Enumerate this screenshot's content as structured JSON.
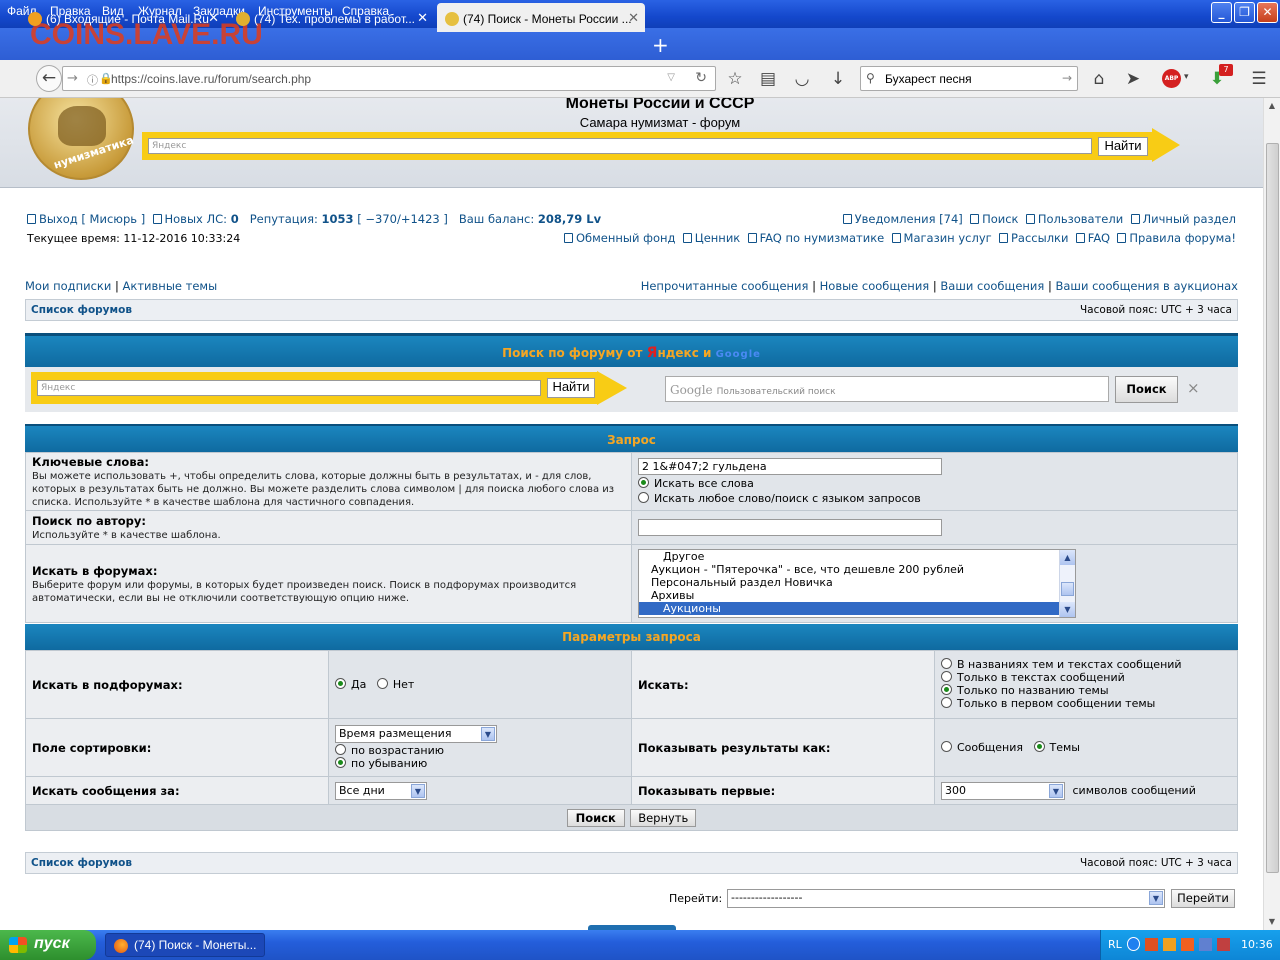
{
  "menu": [
    "Файл",
    "Правка",
    "Вид",
    "Журнал",
    "Закладки",
    "Инструменты",
    "Справка"
  ],
  "watermark": "COINS.LAVE.RU",
  "tabs": [
    {
      "label": "(6) Входящие - Почта Mail.Ru"
    },
    {
      "label": "(74) Тех. проблемы в работ..."
    },
    {
      "label": "(74) Поиск - Монеты России ..."
    }
  ],
  "url": "https://coins.lave.ru/forum/search.php",
  "browser_search": "Бухарест песня",
  "abp_badge": "ABP",
  "download_badge": "7",
  "site": {
    "title": "Монеты России и СССР",
    "subtitle": "Самара нумизмат - форум",
    "logo_text": "нумизматика",
    "yandex_placeholder": "Яндекс",
    "find_button": "Найти"
  },
  "userbar": {
    "logout": "Выход [ Мисюрь ]",
    "new_pm_label": "Новых ЛС:",
    "new_pm": "0",
    "reputation_label": "Репутация:",
    "reputation": "1053",
    "reputation_range": "[ −370/+1423 ]",
    "balance_label": "Ваш баланс:",
    "balance": "208,79 Lv",
    "current_time": "Текущее время: 11-12-2016 10:33:24",
    "right_row1": [
      "Уведомления [74]",
      "Поиск",
      "Пользователи",
      "Личный раздел"
    ],
    "right_row2": [
      "Обменный фонд",
      "Ценник",
      "FAQ по нумизматике",
      "Магазин услуг",
      "Рассылки",
      "FAQ",
      "Правила форума!"
    ]
  },
  "links_left": [
    "Мои подписки",
    "Активные темы"
  ],
  "links_right": [
    "Непрочитанные сообщения",
    "Новые сообщения",
    "Ваши сообщения",
    "Ваши сообщения в аукционах"
  ],
  "breadcrumb": "Список форумов",
  "timezone": "Часовой пояс: UTC + 3 часа",
  "search_section": {
    "title_prefix": "Поиск по форуму от ",
    "ya_Y": "Я",
    "ya_rest": "ндекс",
    "and": " и ",
    "google": "Google",
    "yandex_placeholder": "Яндекс",
    "find_button": "Найти",
    "google_placeholder": "Пользовательский поиск",
    "google_button": "Поиск",
    "clear": "×"
  },
  "query": {
    "header": "Запрос",
    "keywords_label": "Ключевые слова:",
    "keywords_help": "Вы можете использовать +, чтобы определить слова, которые должны быть в результатах, и - для слов, которых в результатах быть не должно. Вы можете разделить слова символом | для поиска любого слова из списка. Используйте * в качестве шаблона для частичного совпадения.",
    "keywords_value": "2 1&#047;2 гульдена",
    "opt_all": "Искать все слова",
    "opt_any": "Искать любое слово/поиск с языком запросов",
    "author_label": "Поиск по автору:",
    "author_help": "Используйте * в качестве шаблона.",
    "author_value": "",
    "forums_label": "Искать в форумах:",
    "forums_help": "Выберите форум или форумы, в которых будет произведен поиск. Поиск в подфорумах производится автоматически, если вы не отключили соответствующую опцию ниже.",
    "forums_list": [
      "Другое",
      "Аукцион - \"Пятерочка\" - все, что дешевле 200 рублей",
      "Персональный раздел Новичка",
      "Архивы",
      "Аукционы"
    ]
  },
  "params": {
    "header": "Параметры запроса",
    "subforums_label": "Искать в подфорумах:",
    "yes": "Да",
    "no": "Нет",
    "search_in_label": "Искать:",
    "search_in": [
      "В названиях тем и текстах сообщений",
      "Только в текстах сообщений",
      "Только по названию темы",
      "Только в первом сообщении темы"
    ],
    "sort_label": "Поле сортировки:",
    "sort_value": "Время размещения",
    "asc": "по возрастанию",
    "desc": "по убыванию",
    "show_as_label": "Показывать результаты как:",
    "show_posts": "Сообщения",
    "show_topics": "Темы",
    "period_label": "Искать сообщения за:",
    "period_value": "Все дни",
    "first_label": "Показывать первые:",
    "first_value": "300",
    "first_suffix": "символов сообщений",
    "search_button": "Поиск",
    "reset_button": "Вернуть"
  },
  "jump": {
    "label": "Перейти:",
    "value": "------------------",
    "button": "Перейти"
  },
  "taskbar": {
    "start": "пуск",
    "window": "(74) Поиск - Монеты...",
    "lang": "RL",
    "clock": "10:36"
  }
}
